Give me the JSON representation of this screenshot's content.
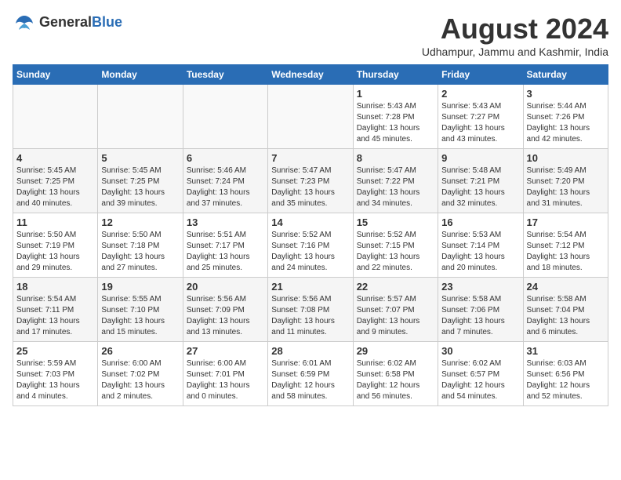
{
  "header": {
    "logo_general": "General",
    "logo_blue": "Blue",
    "month_year": "August 2024",
    "location": "Udhampur, Jammu and Kashmir, India"
  },
  "days_of_week": [
    "Sunday",
    "Monday",
    "Tuesday",
    "Wednesday",
    "Thursday",
    "Friday",
    "Saturday"
  ],
  "weeks": [
    [
      {
        "day": "",
        "info": ""
      },
      {
        "day": "",
        "info": ""
      },
      {
        "day": "",
        "info": ""
      },
      {
        "day": "",
        "info": ""
      },
      {
        "day": "1",
        "info": "Sunrise: 5:43 AM\nSunset: 7:28 PM\nDaylight: 13 hours\nand 45 minutes."
      },
      {
        "day": "2",
        "info": "Sunrise: 5:43 AM\nSunset: 7:27 PM\nDaylight: 13 hours\nand 43 minutes."
      },
      {
        "day": "3",
        "info": "Sunrise: 5:44 AM\nSunset: 7:26 PM\nDaylight: 13 hours\nand 42 minutes."
      }
    ],
    [
      {
        "day": "4",
        "info": "Sunrise: 5:45 AM\nSunset: 7:25 PM\nDaylight: 13 hours\nand 40 minutes."
      },
      {
        "day": "5",
        "info": "Sunrise: 5:45 AM\nSunset: 7:25 PM\nDaylight: 13 hours\nand 39 minutes."
      },
      {
        "day": "6",
        "info": "Sunrise: 5:46 AM\nSunset: 7:24 PM\nDaylight: 13 hours\nand 37 minutes."
      },
      {
        "day": "7",
        "info": "Sunrise: 5:47 AM\nSunset: 7:23 PM\nDaylight: 13 hours\nand 35 minutes."
      },
      {
        "day": "8",
        "info": "Sunrise: 5:47 AM\nSunset: 7:22 PM\nDaylight: 13 hours\nand 34 minutes."
      },
      {
        "day": "9",
        "info": "Sunrise: 5:48 AM\nSunset: 7:21 PM\nDaylight: 13 hours\nand 32 minutes."
      },
      {
        "day": "10",
        "info": "Sunrise: 5:49 AM\nSunset: 7:20 PM\nDaylight: 13 hours\nand 31 minutes."
      }
    ],
    [
      {
        "day": "11",
        "info": "Sunrise: 5:50 AM\nSunset: 7:19 PM\nDaylight: 13 hours\nand 29 minutes."
      },
      {
        "day": "12",
        "info": "Sunrise: 5:50 AM\nSunset: 7:18 PM\nDaylight: 13 hours\nand 27 minutes."
      },
      {
        "day": "13",
        "info": "Sunrise: 5:51 AM\nSunset: 7:17 PM\nDaylight: 13 hours\nand 25 minutes."
      },
      {
        "day": "14",
        "info": "Sunrise: 5:52 AM\nSunset: 7:16 PM\nDaylight: 13 hours\nand 24 minutes."
      },
      {
        "day": "15",
        "info": "Sunrise: 5:52 AM\nSunset: 7:15 PM\nDaylight: 13 hours\nand 22 minutes."
      },
      {
        "day": "16",
        "info": "Sunrise: 5:53 AM\nSunset: 7:14 PM\nDaylight: 13 hours\nand 20 minutes."
      },
      {
        "day": "17",
        "info": "Sunrise: 5:54 AM\nSunset: 7:12 PM\nDaylight: 13 hours\nand 18 minutes."
      }
    ],
    [
      {
        "day": "18",
        "info": "Sunrise: 5:54 AM\nSunset: 7:11 PM\nDaylight: 13 hours\nand 17 minutes."
      },
      {
        "day": "19",
        "info": "Sunrise: 5:55 AM\nSunset: 7:10 PM\nDaylight: 13 hours\nand 15 minutes."
      },
      {
        "day": "20",
        "info": "Sunrise: 5:56 AM\nSunset: 7:09 PM\nDaylight: 13 hours\nand 13 minutes."
      },
      {
        "day": "21",
        "info": "Sunrise: 5:56 AM\nSunset: 7:08 PM\nDaylight: 13 hours\nand 11 minutes."
      },
      {
        "day": "22",
        "info": "Sunrise: 5:57 AM\nSunset: 7:07 PM\nDaylight: 13 hours\nand 9 minutes."
      },
      {
        "day": "23",
        "info": "Sunrise: 5:58 AM\nSunset: 7:06 PM\nDaylight: 13 hours\nand 7 minutes."
      },
      {
        "day": "24",
        "info": "Sunrise: 5:58 AM\nSunset: 7:04 PM\nDaylight: 13 hours\nand 6 minutes."
      }
    ],
    [
      {
        "day": "25",
        "info": "Sunrise: 5:59 AM\nSunset: 7:03 PM\nDaylight: 13 hours\nand 4 minutes."
      },
      {
        "day": "26",
        "info": "Sunrise: 6:00 AM\nSunset: 7:02 PM\nDaylight: 13 hours\nand 2 minutes."
      },
      {
        "day": "27",
        "info": "Sunrise: 6:00 AM\nSunset: 7:01 PM\nDaylight: 13 hours\nand 0 minutes."
      },
      {
        "day": "28",
        "info": "Sunrise: 6:01 AM\nSunset: 6:59 PM\nDaylight: 12 hours\nand 58 minutes."
      },
      {
        "day": "29",
        "info": "Sunrise: 6:02 AM\nSunset: 6:58 PM\nDaylight: 12 hours\nand 56 minutes."
      },
      {
        "day": "30",
        "info": "Sunrise: 6:02 AM\nSunset: 6:57 PM\nDaylight: 12 hours\nand 54 minutes."
      },
      {
        "day": "31",
        "info": "Sunrise: 6:03 AM\nSunset: 6:56 PM\nDaylight: 12 hours\nand 52 minutes."
      }
    ]
  ]
}
